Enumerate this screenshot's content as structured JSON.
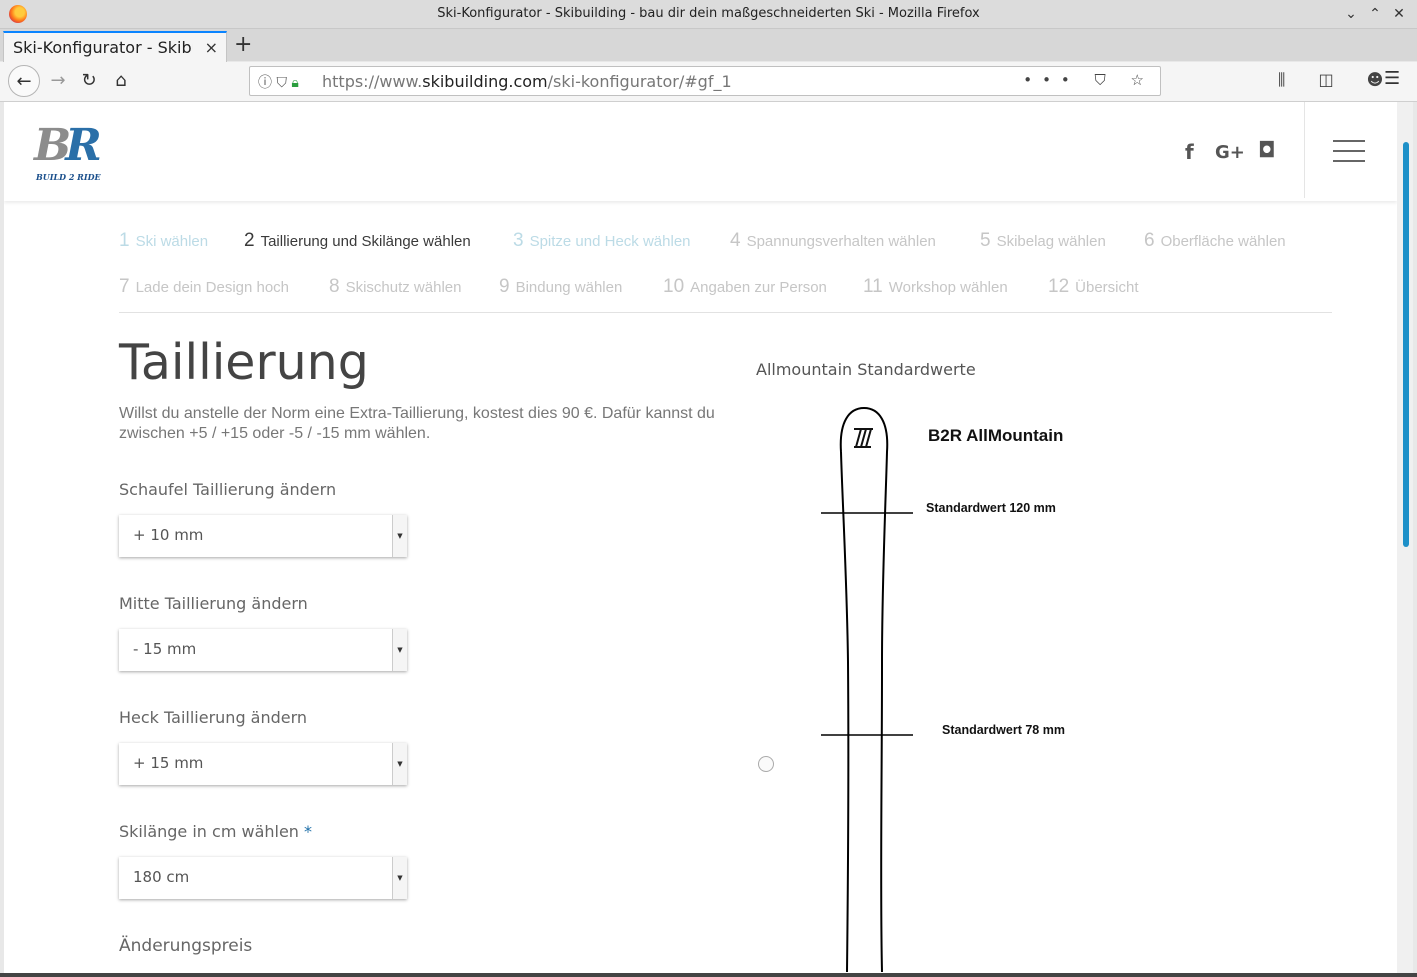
{
  "window": {
    "title": "Ski-Konfigurator - Skibuilding - bau dir dein maßgeschneiderten Ski - Mozilla Firefox"
  },
  "tab": {
    "title": "Ski-Konfigurator - Skibu",
    "close": "×",
    "new_tab": "+"
  },
  "nav": {
    "url_prefix": "https://www.",
    "url_domain": "skibuilding.com",
    "url_path": "/ski-konfigurator/#gf_1"
  },
  "header": {
    "logo_text_b": "B",
    "logo_text_r": "R",
    "logo_tagline": "BUILD 2 RIDE",
    "social": {
      "facebook": "f",
      "googleplus": "G+",
      "instagram": "◘"
    }
  },
  "steps": [
    {
      "num": "1",
      "label": "Ski wählen"
    },
    {
      "num": "2",
      "label": "Taillierung und Skilänge wählen"
    },
    {
      "num": "3",
      "label": "Spitze und Heck wählen"
    },
    {
      "num": "4",
      "label": "Spannungsverhalten wählen"
    },
    {
      "num": "5",
      "label": "Skibelag wählen"
    },
    {
      "num": "6",
      "label": "Oberfläche wählen"
    },
    {
      "num": "7",
      "label": "Lade dein Design hoch"
    },
    {
      "num": "8",
      "label": "Skischutz wählen"
    },
    {
      "num": "9",
      "label": "Bindung wählen"
    },
    {
      "num": "10",
      "label": "Angaben zur Person"
    },
    {
      "num": "11",
      "label": "Workshop wählen"
    },
    {
      "num": "12",
      "label": "Übersicht"
    }
  ],
  "form": {
    "title": "Taillierung",
    "description": "Willst du anstelle der Norm eine Extra-Taillierung, kostest dies 90 €. Dafür kannst du zwischen +5 / +15 oder -5 / -15 mm wählen.",
    "fields": [
      {
        "label": "Schaufel Taillierung ändern",
        "value": "+ 10 mm"
      },
      {
        "label": "Mitte Taillierung ändern",
        "value": "- 15 mm"
      },
      {
        "label": "Heck Taillierung ändern",
        "value": "+ 15 mm"
      },
      {
        "label": "Skilänge in cm wählen",
        "value": "180 cm",
        "required": "*"
      }
    ],
    "price_label": "Änderungspreis"
  },
  "preview": {
    "title": "Allmountain Standardwerte",
    "ski_name": "B2R AllMountain",
    "standard_top": "Standardwert 120 mm",
    "standard_mid": "Standardwert 78 mm"
  }
}
